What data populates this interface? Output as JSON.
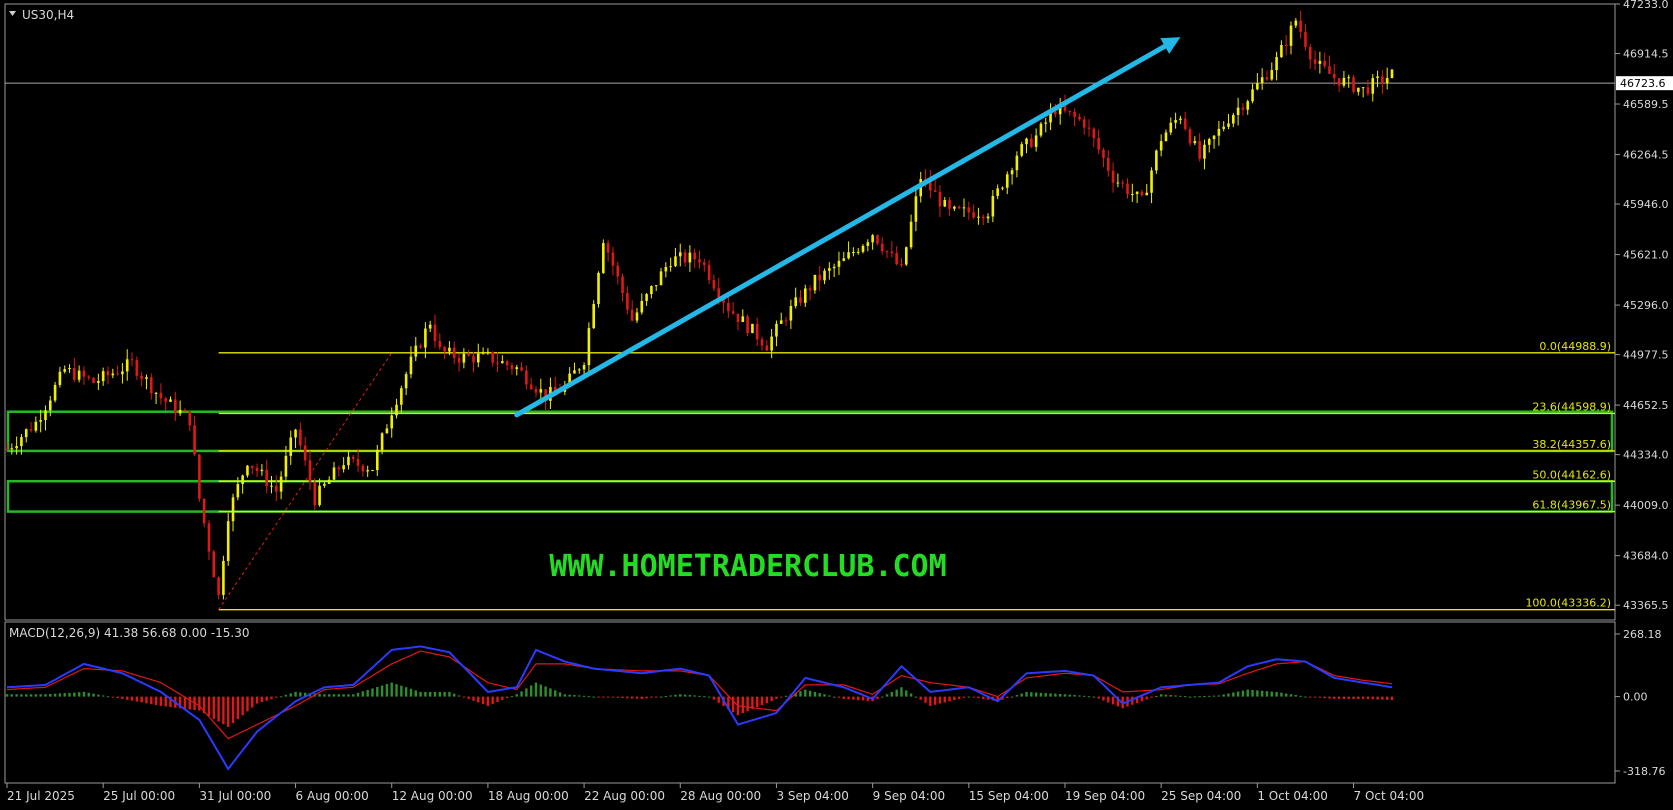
{
  "chart_data": {
    "type": "line",
    "symbol_label": "US30,H4",
    "watermark": "WWW.HOMETRADERCLUB.COM",
    "last_price_label": "46723.6",
    "last_price": 46723.6,
    "price_axis": {
      "ylim": [
        43270,
        47233
      ],
      "ticks": [
        "47233.0",
        "46914.5",
        "46589.5",
        "46264.5",
        "45946.0",
        "45621.0",
        "45296.0",
        "44977.5",
        "44652.5",
        "44334.0",
        "44009.0",
        "43684.0",
        "43365.5"
      ],
      "tick_values": [
        47233.0,
        46914.5,
        46589.5,
        46264.5,
        45946.0,
        45621.0,
        45296.0,
        44977.5,
        44652.5,
        44334.0,
        44009.0,
        43684.0,
        43365.5
      ]
    },
    "time_axis": {
      "labels": [
        "21 Jul 2025",
        "25 Jul 00:00",
        "31 Jul 00:00",
        "6 Aug 00:00",
        "12 Aug 00:00",
        "18 Aug 00:00",
        "22 Aug 00:00",
        "28 Aug 00:00",
        "3 Sep 04:00",
        "9 Sep 04:00",
        "15 Sep 04:00",
        "19 Sep 04:00",
        "25 Sep 04:00",
        "1 Oct 04:00",
        "7 Oct 04:00"
      ],
      "bar_index": [
        0,
        20,
        40,
        60,
        80,
        100,
        120,
        140,
        160,
        180,
        200,
        220,
        240,
        260,
        280
      ],
      "total_bars": 288
    },
    "series": [
      {
        "kind": "close-path",
        "bar_index": [
          0,
          6,
          12,
          18,
          26,
          32,
          38,
          40,
          44,
          46,
          50,
          56,
          60,
          64,
          70,
          76,
          80,
          84,
          88,
          90,
          94,
          100,
          106,
          112,
          116,
          120,
          124,
          130,
          138,
          144,
          150,
          158,
          162,
          168,
          174,
          180,
          186,
          190,
          196,
          204,
          210,
          214,
          218,
          224,
          230,
          236,
          240,
          244,
          248,
          254,
          258,
          264,
          268,
          272,
          276,
          282,
          288
        ],
        "close": [
          44370,
          44540,
          44880,
          44800,
          44920,
          44700,
          44560,
          44050,
          43420,
          43950,
          44300,
          44100,
          44500,
          44050,
          44290,
          44250,
          44620,
          44930,
          45190,
          45000,
          44960,
          44960,
          44890,
          44710,
          44770,
          44950,
          45730,
          45200,
          45590,
          45600,
          45280,
          45040,
          45230,
          45450,
          45580,
          45760,
          45520,
          46120,
          45890,
          45900,
          46270,
          46380,
          46560,
          46470,
          46120,
          45960,
          46370,
          46520,
          46240,
          46500,
          46630,
          46870,
          47130,
          46850,
          46760,
          46680,
          46780
        ]
      }
    ],
    "fibonacci": {
      "levels": [
        {
          "label": "0.0(44988.9)",
          "price": 44988.9
        },
        {
          "label": "23.6(44598.9)",
          "price": 44598.9
        },
        {
          "label": "38.2(44357.6)",
          "price": 44357.6
        },
        {
          "label": "50.0(44162.6)",
          "price": 44162.6
        },
        {
          "label": "61.8(43967.5)",
          "price": 43967.5
        },
        {
          "label": "100.0(43336.2)",
          "price": 43336.2
        }
      ],
      "anchor_low": {
        "bar": 44,
        "price": 43336.2
      },
      "anchor_high": {
        "bar": 80,
        "price": 44988.9
      }
    },
    "zones": [
      {
        "name": "zone-upper",
        "top": 44610,
        "bottom": 44357.6
      },
      {
        "name": "zone-lower",
        "top": 44162.6,
        "bottom": 43967.5
      }
    ],
    "trend_arrow": {
      "start": {
        "bar": 106,
        "price": 44590
      },
      "end": {
        "bar": 244,
        "price": 47020
      }
    },
    "macd": {
      "label": "MACD(12,26,9) 41.38 56.68 0.00 -15.30",
      "ticks": [
        "268.18",
        "0.00",
        "-318.76"
      ],
      "tick_values": [
        268.18,
        0.0,
        -318.76
      ],
      "ylim": [
        -318.76,
        268.18
      ],
      "bar_index": [
        0,
        8,
        16,
        24,
        32,
        40,
        46,
        52,
        60,
        66,
        72,
        80,
        86,
        92,
        100,
        106,
        110,
        116,
        122,
        132,
        140,
        146,
        152,
        160,
        166,
        174,
        180,
        186,
        192,
        200,
        206,
        212,
        220,
        226,
        232,
        240,
        246,
        252,
        258,
        264,
        270,
        276,
        282,
        288
      ],
      "blue": [
        40,
        50,
        140,
        100,
        20,
        -100,
        -310,
        -150,
        -20,
        40,
        50,
        200,
        215,
        190,
        20,
        40,
        200,
        150,
        120,
        100,
        120,
        90,
        -120,
        -70,
        80,
        40,
        -10,
        130,
        20,
        40,
        -20,
        100,
        110,
        90,
        -30,
        40,
        50,
        60,
        130,
        160,
        150,
        80,
        60,
        40
      ],
      "red": [
        30,
        40,
        120,
        110,
        60,
        -40,
        -180,
        -120,
        -40,
        30,
        40,
        140,
        195,
        170,
        60,
        30,
        140,
        140,
        120,
        110,
        110,
        90,
        -40,
        -60,
        50,
        50,
        10,
        90,
        60,
        40,
        0,
        80,
        100,
        90,
        20,
        30,
        50,
        55,
        100,
        140,
        150,
        90,
        70,
        55
      ]
    }
  }
}
